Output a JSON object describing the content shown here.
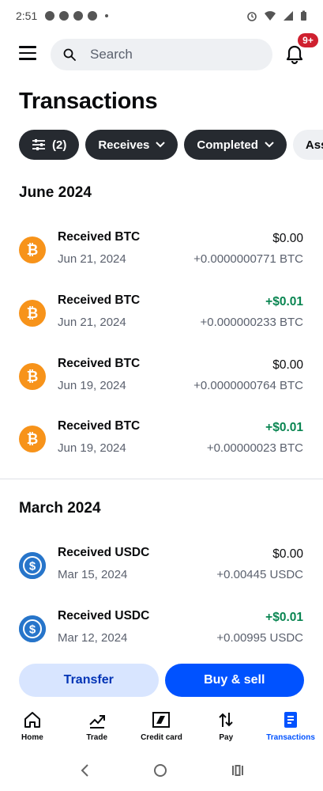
{
  "status_bar": {
    "time": "2:51"
  },
  "search": {
    "placeholder": "Search"
  },
  "notifications": {
    "badge": "9+"
  },
  "page_title": "Transactions",
  "filters": [
    {
      "label": "(2)",
      "icon": "sliders-icon"
    },
    {
      "label": "Receives",
      "icon": "chevron-down-icon"
    },
    {
      "label": "Completed",
      "icon": "chevron-down-icon"
    },
    {
      "label": "Ass"
    }
  ],
  "sections": [
    {
      "title": "June 2024",
      "transactions": [
        {
          "title": "Received BTC",
          "date": "Jun 21, 2024",
          "fiat": "$0.00",
          "crypto": "+0.0000000771 BTC",
          "asset": "btc",
          "positive": false
        },
        {
          "title": "Received BTC",
          "date": "Jun 21, 2024",
          "fiat": "+$0.01",
          "crypto": "+0.000000233 BTC",
          "asset": "btc",
          "positive": true
        },
        {
          "title": "Received BTC",
          "date": "Jun 19, 2024",
          "fiat": "$0.00",
          "crypto": "+0.0000000764 BTC",
          "asset": "btc",
          "positive": false
        },
        {
          "title": "Received BTC",
          "date": "Jun 19, 2024",
          "fiat": "+$0.01",
          "crypto": "+0.00000023 BTC",
          "asset": "btc",
          "positive": true
        }
      ]
    },
    {
      "title": "March 2024",
      "transactions": [
        {
          "title": "Received USDC",
          "date": "Mar 15, 2024",
          "fiat": "$0.00",
          "crypto": "+0.00445 USDC",
          "asset": "usdc",
          "positive": false
        },
        {
          "title": "Received USDC",
          "date": "Mar 12, 2024",
          "fiat": "+$0.01",
          "crypto": "+0.00995 USDC",
          "asset": "usdc",
          "positive": true
        }
      ]
    }
  ],
  "actions": {
    "transfer": "Transfer",
    "buy_sell": "Buy & sell"
  },
  "bottom_nav": [
    {
      "label": "Home",
      "icon": "home-icon",
      "active": false
    },
    {
      "label": "Trade",
      "icon": "trade-icon",
      "active": false
    },
    {
      "label": "Credit card",
      "icon": "credit-card-icon",
      "active": false
    },
    {
      "label": "Pay",
      "icon": "pay-icon",
      "active": false
    },
    {
      "label": "Transactions",
      "icon": "transactions-icon",
      "active": true
    }
  ],
  "colors": {
    "accent": "#0052ff",
    "positive": "#098551",
    "btc": "#f7931a",
    "usdc": "#2775ca",
    "badge": "#cf202f"
  }
}
